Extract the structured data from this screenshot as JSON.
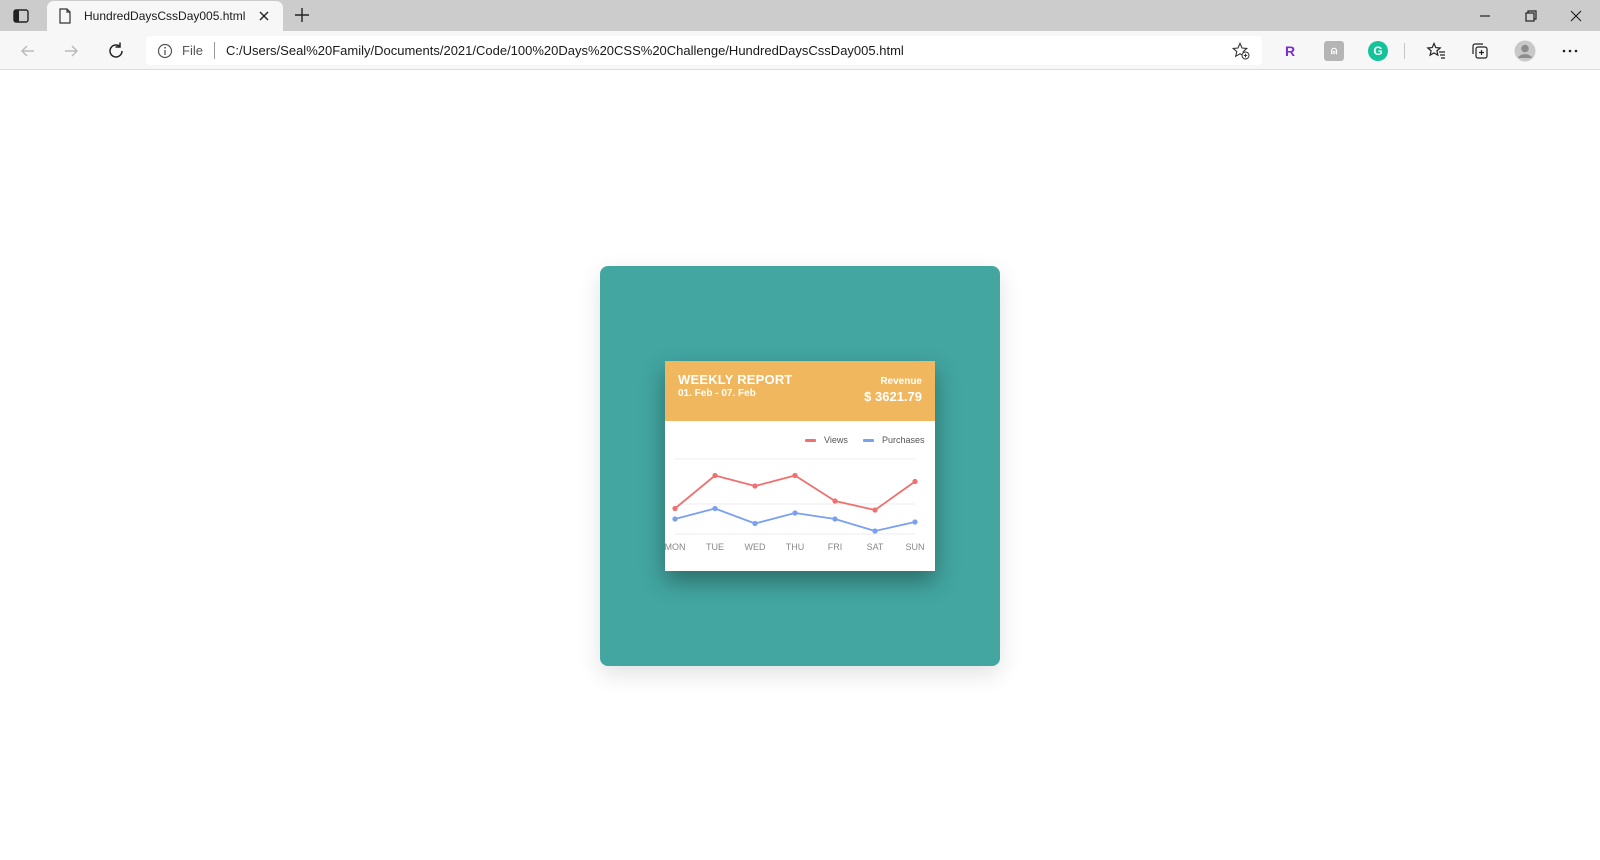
{
  "browser": {
    "tab_title": "HundredDaysCssDay005.html",
    "address_scheme": "File",
    "url": "C:/Users/Seal%20Family/Documents/2021/Code/100%20Days%20CSS%20Challenge/HundredDaysCssDay005.html",
    "extensions": [
      {
        "name": "extension-r-icon",
        "glyph": "R",
        "color": "#7b2ad8"
      },
      {
        "name": "extension-gray-icon",
        "glyph": "⍝",
        "color": "#9a9a9a"
      },
      {
        "name": "grammarly-icon",
        "glyph": "G",
        "color": "#15c39a"
      }
    ]
  },
  "card": {
    "title": "WEEKLY REPORT",
    "dates": "01. Feb - 07. Feb",
    "revenue_label": "Revenue",
    "revenue_value": "$ 3621.79"
  },
  "colors": {
    "stage": "#43a6a1",
    "header": "#f0b75f",
    "views": "#f07070",
    "purchases": "#7aa0f0"
  },
  "chart_data": {
    "type": "line",
    "title": "",
    "xlabel": "",
    "ylabel": "",
    "categories": [
      "MON",
      "TUE",
      "WED",
      "THU",
      "FRI",
      "SAT",
      "SUN"
    ],
    "series": [
      {
        "name": "Views",
        "color": "#f07070",
        "values": [
          1.7,
          3.9,
          3.2,
          3.9,
          2.2,
          1.6,
          3.5
        ]
      },
      {
        "name": "Purchases",
        "color": "#7aa0f0",
        "values": [
          1.0,
          1.7,
          0.7,
          1.4,
          1.0,
          0.2,
          0.8
        ]
      }
    ],
    "ylim": [
      0,
      5
    ],
    "grid": true,
    "legend": "top-right"
  }
}
